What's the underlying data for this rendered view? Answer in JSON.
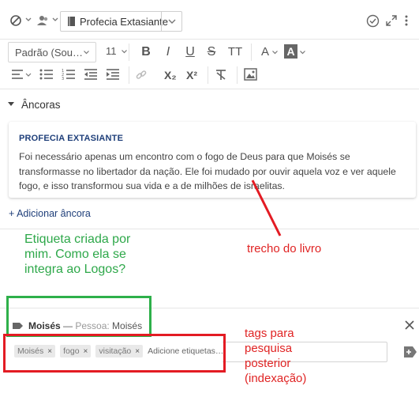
{
  "toolbar": {
    "style_label": "Profecia Extasiante",
    "font_name": "Padrão (Sou…",
    "font_size": "11",
    "subscript_label": "X₂",
    "superscript_label": "X²"
  },
  "anchors": {
    "header": "Âncoras",
    "card": {
      "title": "PROFECIA EXTASIANTE",
      "text": "Foi necessário apenas um encontro com o fogo de Deus para que Moisés se transformasse no libertador da nação. Ele foi mudado por ouvir aquela voz e ver aquele fogo, e isso transformou sua vida e a de milhões de israelitas."
    },
    "add_label": "+ Adicionar âncora"
  },
  "tag": {
    "name": "Moisés",
    "separator": " — ",
    "type_label": "Pessoa:",
    "type_value": " Moisés",
    "chips": [
      "Moisés",
      "fogo",
      "visitação"
    ],
    "input_placeholder": "Adicione etiquetas…"
  },
  "annotations": {
    "green_note": "Etiqueta criada por mim. Como ela se integra ao Logos?",
    "red_note_book": "trecho do livro",
    "red_note_tags": "tags para pesquisa posterior (indexação)"
  },
  "colors": {
    "link": "#1f3f7a",
    "annotation_green": "#2eb04a",
    "annotation_red": "#e31b23"
  }
}
